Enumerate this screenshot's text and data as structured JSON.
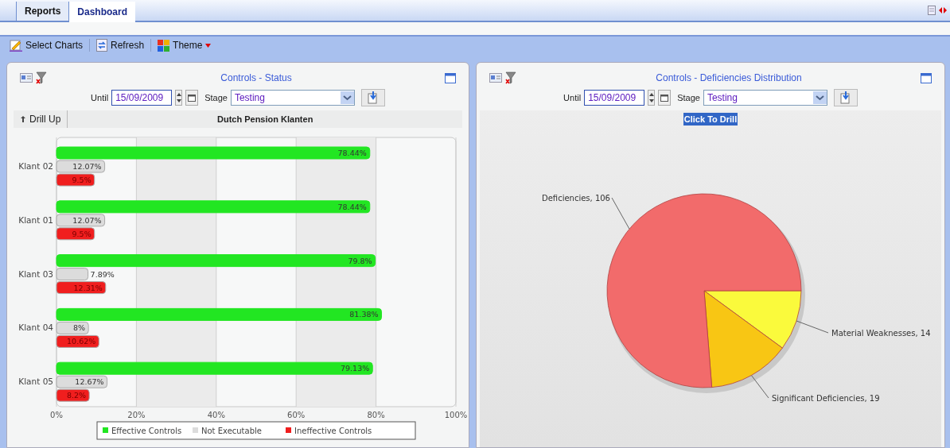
{
  "tabs": [
    {
      "label": "Reports",
      "selected": false
    },
    {
      "label": "Dashboard",
      "selected": true
    }
  ],
  "toolbar": [
    {
      "label": "Select Charts",
      "kind": "select"
    },
    {
      "label": "Refresh",
      "kind": "refresh"
    },
    {
      "label": "Theme",
      "kind": "theme"
    }
  ],
  "status_panel": {
    "title": "Controls - Status",
    "until_label": "Until",
    "until": "15/09/2009",
    "stage_label": "Stage",
    "stage": "Testing",
    "drill_up": "Drill Up",
    "subtitle": "Dutch Pension Klanten",
    "chart_data": {
      "type": "bar",
      "orientation": "horizontal",
      "grid": true,
      "legend": true,
      "categories": [
        "Klant 02",
        "Klant 01",
        "Klant 03",
        "Klant 04",
        "Klant 05"
      ],
      "series": [
        {
          "name": "Effective Controls",
          "color": "#22e622",
          "values": [
            78.44,
            78.44,
            79.8,
            81.38,
            79.13
          ],
          "value_labels": [
            "78.44%",
            "78.44%",
            "79.8%",
            "81.38%",
            "79.13%"
          ]
        },
        {
          "name": "Not Executable",
          "color": "#dcdcdc",
          "values": [
            12.07,
            12.07,
            7.89,
            8,
            12.67
          ],
          "value_labels": [
            "12.07%",
            "12.07%",
            "7.89%",
            "8%",
            "12.67%"
          ]
        },
        {
          "name": "Ineffective Controls",
          "color": "#f01e1e",
          "values": [
            9.5,
            9.5,
            12.31,
            10.62,
            8.2
          ],
          "value_labels": [
            "9.5%",
            "9.5%",
            "12.31%",
            "10.62%",
            "8.2%"
          ]
        }
      ],
      "xlim": [
        0,
        100
      ],
      "xticks": [
        {
          "value": 0,
          "label": "0%"
        },
        {
          "value": 20,
          "label": "20%"
        },
        {
          "value": 40,
          "label": "40%"
        },
        {
          "value": 60,
          "label": "60%"
        },
        {
          "value": 80,
          "label": "80%"
        },
        {
          "value": 100,
          "label": "100%"
        }
      ]
    }
  },
  "distribution_panel": {
    "title": "Controls - Deficiencies Distribution",
    "until_label": "Until",
    "until": "15/09/2009",
    "stage_label": "Stage",
    "stage": "Testing",
    "drill_hint": "Click To Drill",
    "chart_data": {
      "type": "pie",
      "categories": [
        "Deficiencies",
        "Significant Deficiencies",
        "Material Weaknesses"
      ],
      "series": [
        {
          "colors": [
            "#f26b6b",
            "#f8c614",
            "#fafa3c"
          ],
          "values": [
            106,
            19,
            14
          ],
          "value_labels": [
            ", 106",
            ", 19",
            ", 14"
          ]
        }
      ]
    }
  }
}
